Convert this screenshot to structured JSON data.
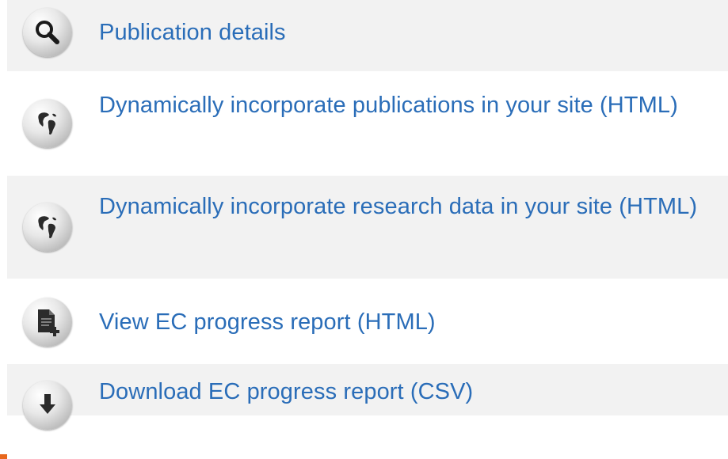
{
  "actions": {
    "items": [
      {
        "label": "Publication details",
        "icon": "search-icon"
      },
      {
        "label": "Dynamically incorporate publications in your site (HTML)",
        "icon": "globe-icon"
      },
      {
        "label": "Dynamically incorporate research data in your site (HTML)",
        "icon": "globe-icon"
      },
      {
        "label": "View EC progress report (HTML)",
        "icon": "document-add-icon"
      },
      {
        "label": "Download EC progress report (CSV)",
        "icon": "download-icon"
      }
    ]
  },
  "colors": {
    "link": "#2a6db8",
    "accent_border": "#e8671c",
    "row_shade": "#f2f2f2"
  }
}
